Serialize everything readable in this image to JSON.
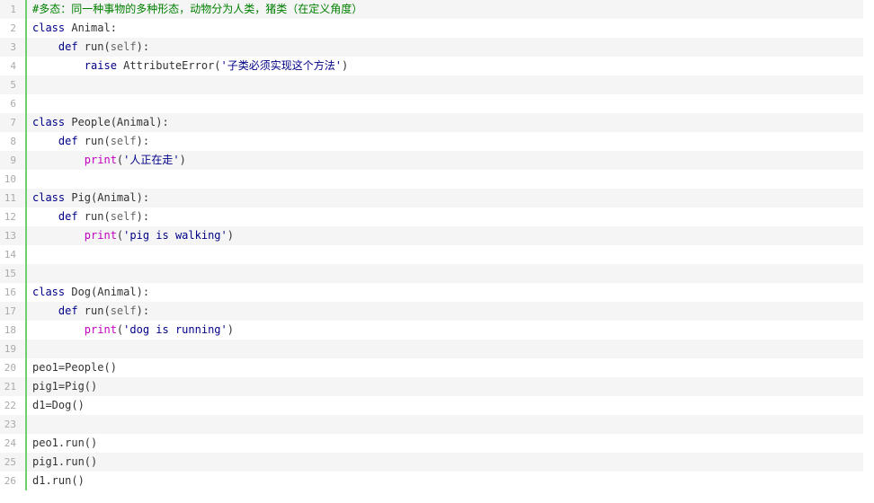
{
  "colors": {
    "gutter_border": "#6ecf6e",
    "line_number": "#aaaaaa",
    "stripe": "#f5f5f5",
    "keyword": "#000088",
    "print": "#c000c0",
    "comment": "#008000"
  },
  "lines": [
    {
      "num": "1",
      "tokens": [
        {
          "t": "#多态：同一种事物的多种形态，动物分为人类，猪类（在定义角度）",
          "c": "comment"
        }
      ]
    },
    {
      "num": "2",
      "tokens": [
        {
          "t": "class ",
          "c": "kw"
        },
        {
          "t": "Animal:",
          "c": "plain"
        }
      ]
    },
    {
      "num": "3",
      "tokens": [
        {
          "t": "    def ",
          "c": "kw"
        },
        {
          "t": "run(",
          "c": "plain"
        },
        {
          "t": "self",
          "c": "self"
        },
        {
          "t": "):",
          "c": "plain"
        }
      ]
    },
    {
      "num": "4",
      "tokens": [
        {
          "t": "        raise ",
          "c": "kw"
        },
        {
          "t": "AttributeError(",
          "c": "plain"
        },
        {
          "t": "'子类必须实现这个方法'",
          "c": "str"
        },
        {
          "t": ")",
          "c": "plain"
        }
      ]
    },
    {
      "num": "5",
      "tokens": []
    },
    {
      "num": "6",
      "tokens": []
    },
    {
      "num": "7",
      "tokens": [
        {
          "t": "class ",
          "c": "kw"
        },
        {
          "t": "People(Animal):",
          "c": "plain"
        }
      ]
    },
    {
      "num": "8",
      "tokens": [
        {
          "t": "    def ",
          "c": "kw"
        },
        {
          "t": "run(",
          "c": "plain"
        },
        {
          "t": "self",
          "c": "self"
        },
        {
          "t": "):",
          "c": "plain"
        }
      ]
    },
    {
      "num": "9",
      "tokens": [
        {
          "t": "        print",
          "c": "print"
        },
        {
          "t": "(",
          "c": "plain"
        },
        {
          "t": "'人正在走'",
          "c": "str"
        },
        {
          "t": ")",
          "c": "plain"
        }
      ]
    },
    {
      "num": "10",
      "tokens": []
    },
    {
      "num": "11",
      "tokens": [
        {
          "t": "class ",
          "c": "kw"
        },
        {
          "t": "Pig(Animal):",
          "c": "plain"
        }
      ]
    },
    {
      "num": "12",
      "tokens": [
        {
          "t": "    def ",
          "c": "kw"
        },
        {
          "t": "run(",
          "c": "plain"
        },
        {
          "t": "self",
          "c": "self"
        },
        {
          "t": "):",
          "c": "plain"
        }
      ]
    },
    {
      "num": "13",
      "tokens": [
        {
          "t": "        print",
          "c": "print"
        },
        {
          "t": "(",
          "c": "plain"
        },
        {
          "t": "'pig is walking'",
          "c": "str"
        },
        {
          "t": ")",
          "c": "plain"
        }
      ]
    },
    {
      "num": "14",
      "tokens": []
    },
    {
      "num": "15",
      "tokens": []
    },
    {
      "num": "16",
      "tokens": [
        {
          "t": "class ",
          "c": "kw"
        },
        {
          "t": "Dog(Animal):",
          "c": "plain"
        }
      ]
    },
    {
      "num": "17",
      "tokens": [
        {
          "t": "    def ",
          "c": "kw"
        },
        {
          "t": "run(",
          "c": "plain"
        },
        {
          "t": "self",
          "c": "self"
        },
        {
          "t": "):",
          "c": "plain"
        }
      ]
    },
    {
      "num": "18",
      "tokens": [
        {
          "t": "        print",
          "c": "print"
        },
        {
          "t": "(",
          "c": "plain"
        },
        {
          "t": "'dog is running'",
          "c": "str"
        },
        {
          "t": ")",
          "c": "plain"
        }
      ]
    },
    {
      "num": "19",
      "tokens": []
    },
    {
      "num": "20",
      "tokens": [
        {
          "t": "peo1=People()",
          "c": "plain"
        }
      ]
    },
    {
      "num": "21",
      "tokens": [
        {
          "t": "pig1=Pig()",
          "c": "plain"
        }
      ]
    },
    {
      "num": "22",
      "tokens": [
        {
          "t": "d1=Dog()",
          "c": "plain"
        }
      ]
    },
    {
      "num": "23",
      "tokens": []
    },
    {
      "num": "24",
      "tokens": [
        {
          "t": "peo1.run()",
          "c": "plain"
        }
      ]
    },
    {
      "num": "25",
      "tokens": [
        {
          "t": "pig1.run()",
          "c": "plain"
        }
      ]
    },
    {
      "num": "26",
      "tokens": [
        {
          "t": "d1.run()",
          "c": "plain"
        }
      ]
    }
  ]
}
